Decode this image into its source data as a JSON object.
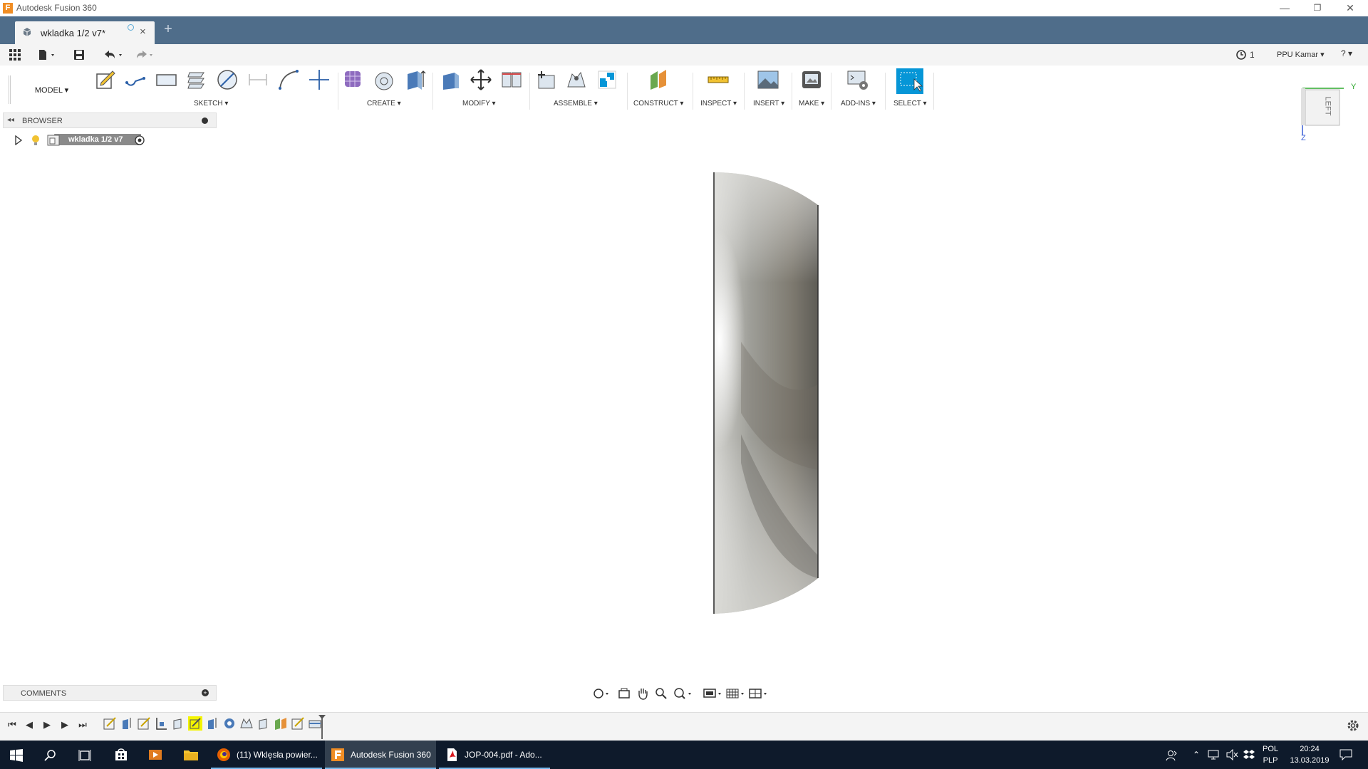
{
  "window": {
    "app_title": "Autodesk Fusion 360",
    "logo_letter": "F",
    "minimize": "—",
    "restore": "❐",
    "close": "✕"
  },
  "document_tab": {
    "label": "wkladka 1/2 v7*",
    "close": "×",
    "new_tab": "+"
  },
  "quick_access": {
    "job_count": "1",
    "user": "PPU Kamar ▾",
    "help": "? ▾"
  },
  "toolbar": {
    "workspace": "MODEL ▾",
    "groups": {
      "sketch": "SKETCH ▾",
      "create": "CREATE ▾",
      "modify": "MODIFY ▾",
      "assemble": "ASSEMBLE ▾",
      "construct": "CONSTRUCT ▾",
      "inspect": "INSPECT ▾",
      "insert": "INSERT ▾",
      "make": "MAKE ▾",
      "addins": "ADD-INS ▾",
      "select": "SELECT ▾"
    }
  },
  "browser": {
    "title": "BROWSER",
    "root_node": "wkladka 1/2 v7"
  },
  "viewcube": {
    "face": "LEFT",
    "axis_y": "Y",
    "axis_z": "Z"
  },
  "comments": {
    "title": "COMMENTS"
  },
  "taskbar": {
    "apps": [
      {
        "label": "(11) Wklęsła powier...",
        "icon": "firefox-icon"
      },
      {
        "label": "Autodesk Fusion 360",
        "icon": "fusion-icon"
      },
      {
        "label": "JOP-004.pdf - Ado...",
        "icon": "pdf-icon"
      }
    ],
    "lang_top": "POL",
    "lang_bottom": "PLP",
    "time": "20:24",
    "date": "13.03.2019"
  },
  "colors": {
    "tab_bar": "#4f6d8a",
    "select_active": "#0696d7",
    "taskbar": "#0e1a2b"
  }
}
